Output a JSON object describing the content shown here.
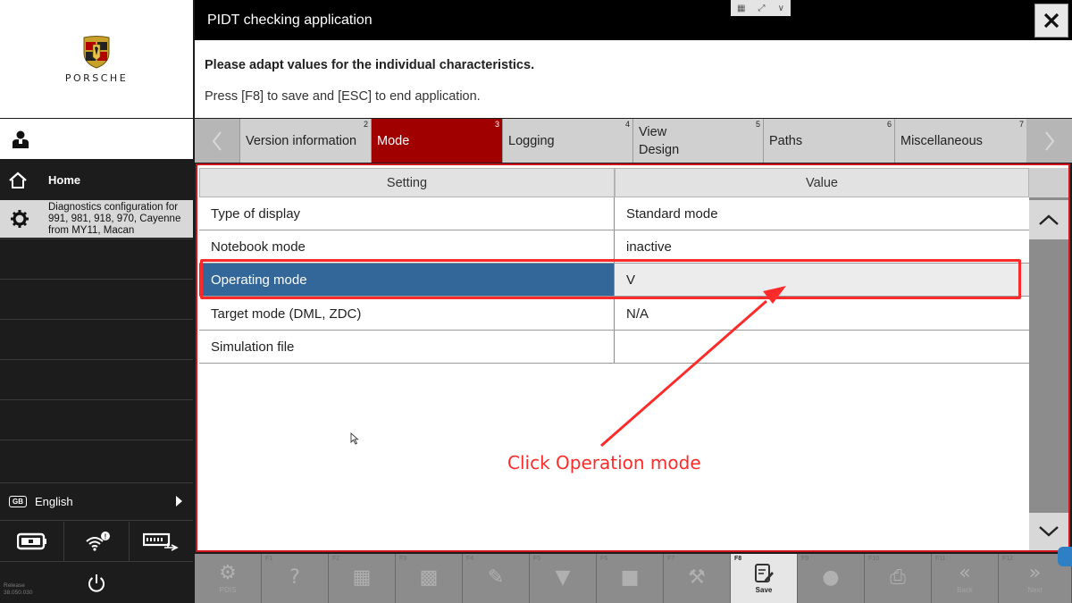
{
  "sidebar": {
    "brand": "PORSCHE",
    "home_label": "Home",
    "diagnostics_label": "Diagnostics configuration for 991, 981, 918, 970, Cayenne from MY11, Macan",
    "language_badge": "GB",
    "language_label": "English",
    "release_label": "Release",
    "release_version": "38.050.030"
  },
  "header": {
    "title": "PIDT checking application",
    "instruction_bold": "Please adapt values for the individual characteristics.",
    "instruction": "Press [F8] to save and [ESC] to end application."
  },
  "tabs": [
    {
      "label": "Version information",
      "num": "2",
      "active": false
    },
    {
      "label": "Mode",
      "num": "3",
      "active": true
    },
    {
      "label": "Logging",
      "num": "4",
      "active": false
    },
    {
      "label": "View Design",
      "num": "5",
      "active": false
    },
    {
      "label": "Paths",
      "num": "6",
      "active": false
    },
    {
      "label": "Miscellaneous",
      "num": "7",
      "active": false
    }
  ],
  "grid": {
    "col_setting": "Setting",
    "col_value": "Value",
    "rows": [
      {
        "setting": "Type of display",
        "value": "Standard mode"
      },
      {
        "setting": "Notebook mode",
        "value": "inactive"
      },
      {
        "setting": "Operating mode",
        "value": "V"
      },
      {
        "setting": "Target mode (DML, ZDC)",
        "value": "N/A"
      },
      {
        "setting": "Simulation file",
        "value": ""
      }
    ],
    "selected_row": 2
  },
  "annotation": {
    "text": "Click Operation mode",
    "color": "#ff2b2b"
  },
  "fkeys": [
    {
      "key": "",
      "label": "PDIS",
      "icon": "pdis-icon",
      "active": false
    },
    {
      "key": "F1",
      "label": "",
      "icon": "help-icon",
      "active": false
    },
    {
      "key": "F2",
      "label": "",
      "icon": "screenshot-icon",
      "active": false
    },
    {
      "key": "F3",
      "label": "",
      "icon": "chart-icon",
      "active": false
    },
    {
      "key": "F4",
      "label": "",
      "icon": "edit-icon",
      "active": false
    },
    {
      "key": "F5",
      "label": "",
      "icon": "filter-icon",
      "active": false
    },
    {
      "key": "F6",
      "label": "",
      "icon": "message-icon",
      "active": false
    },
    {
      "key": "F7",
      "label": "",
      "icon": "tools-icon",
      "active": false
    },
    {
      "key": "F8",
      "label": "Save",
      "icon": "save-icon",
      "active": true
    },
    {
      "key": "F9",
      "label": "",
      "icon": "chat-icon",
      "active": false
    },
    {
      "key": "F10",
      "label": "",
      "icon": "print-icon",
      "active": false
    },
    {
      "key": "F11",
      "label": "Back",
      "icon": "back-icon",
      "active": false
    },
    {
      "key": "F12",
      "label": "Next",
      "icon": "next-icon",
      "active": false
    }
  ],
  "colors": {
    "accent_red": "#a10000",
    "selection_blue": "#336699",
    "frame_red": "#d0141b"
  }
}
